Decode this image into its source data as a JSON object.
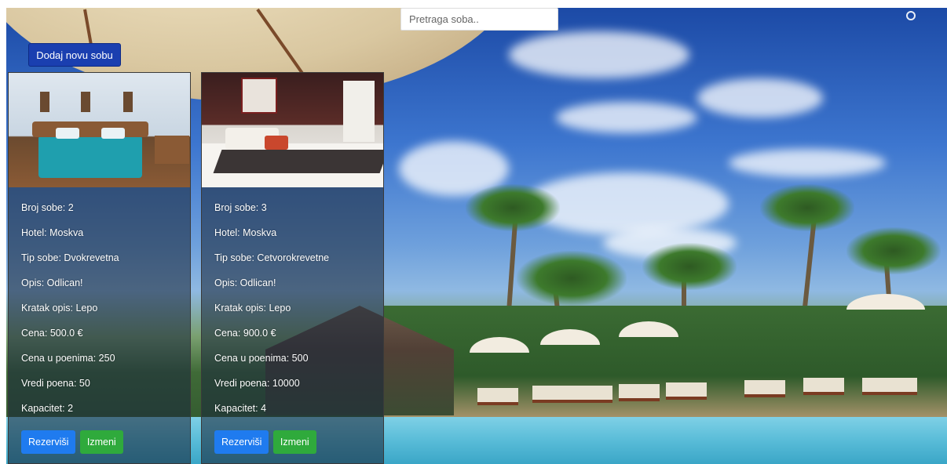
{
  "search": {
    "placeholder": "Pretraga soba.."
  },
  "add_room_label": "Dodaj novu sobu",
  "rooms": [
    {
      "fields": [
        "Broj sobe: 2",
        "Hotel: Moskva",
        "Tip sobe: Dvokrevetna",
        "Opis: Odlican!",
        "Kratak opis: Lepo",
        "Cena: 500.0 €",
        "Cena u poenima: 250",
        "Vredi poena: 50",
        "Kapacitet: 2"
      ],
      "reserve_label": "Rezerviši",
      "edit_label": "Izmeni"
    },
    {
      "fields": [
        "Broj sobe: 3",
        "Hotel: Moskva",
        "Tip sobe: Cetvorokrevetne",
        "Opis: Odlican!",
        "Kratak opis: Lepo",
        "Cena: 900.0 €",
        "Cena u poenima: 500",
        "Vredi poena: 10000",
        "Kapacitet: 4"
      ],
      "reserve_label": "Rezerviši",
      "edit_label": "Izmeni"
    }
  ],
  "colors": {
    "add_button": "#1a3fb0",
    "reserve_button": "#1f7bef",
    "edit_button": "#2faa3c"
  }
}
